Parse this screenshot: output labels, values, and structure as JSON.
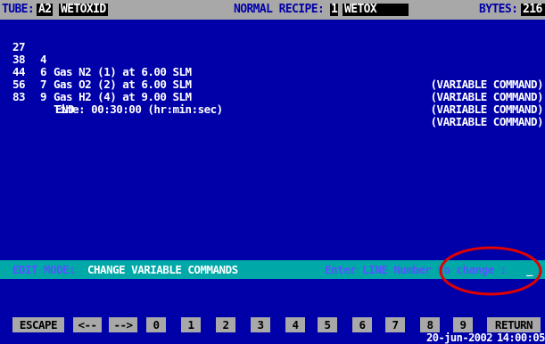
{
  "header": {
    "tube_label": "TUBE:",
    "tube_value": "A2",
    "recipe_name": "WETOXID",
    "normal_recipe_label": "NORMAL RECIPE:",
    "recipe_number": "1",
    "recipe_short": "WETOX",
    "bytes_label": "BYTES:",
    "bytes_value": "216"
  },
  "lines": [
    {
      "num": "27",
      "step": "4",
      "desc": "Gas N2 (1) at 6.00 SLM",
      "tag": "(VARIABLE COMMAND)"
    },
    {
      "num": "38",
      "step": "6",
      "desc": "Gas O2 (2) at 6.00 SLM",
      "tag": "(VARIABLE COMMAND)"
    },
    {
      "num": "44",
      "step": "7",
      "desc": "Gas H2 (4) at 9.00 SLM",
      "tag": "(VARIABLE COMMAND)"
    },
    {
      "num": "56",
      "step": "9",
      "desc": "Time: 00:30:00 (hr:min:sec)",
      "tag": "(VARIABLE COMMAND)"
    },
    {
      "num": "83",
      "step": "",
      "desc": "",
      "end": "END",
      "tag": ""
    }
  ],
  "status": {
    "mode_label": "EDIT MODE:",
    "mode_value": "CHANGE VARIABLE COMMANDS",
    "prompt": "Enter LINE Number to change :",
    "cursor": "_",
    "cursor_suffix": ":"
  },
  "keys": {
    "escape": "ESCAPE",
    "left": "<--",
    "right": "-->",
    "digits": [
      "0",
      "1",
      "2",
      "3",
      "4",
      "5",
      "6",
      "7",
      "8",
      "9"
    ],
    "return": "RETURN"
  },
  "datetime": {
    "date": "20-jun-2002",
    "time": "14:00:05"
  },
  "colors": {
    "background": "#0000a8",
    "header_bar": "#a8a8a8",
    "status_bar": "#00a8a8",
    "annotation": "#e00000"
  }
}
